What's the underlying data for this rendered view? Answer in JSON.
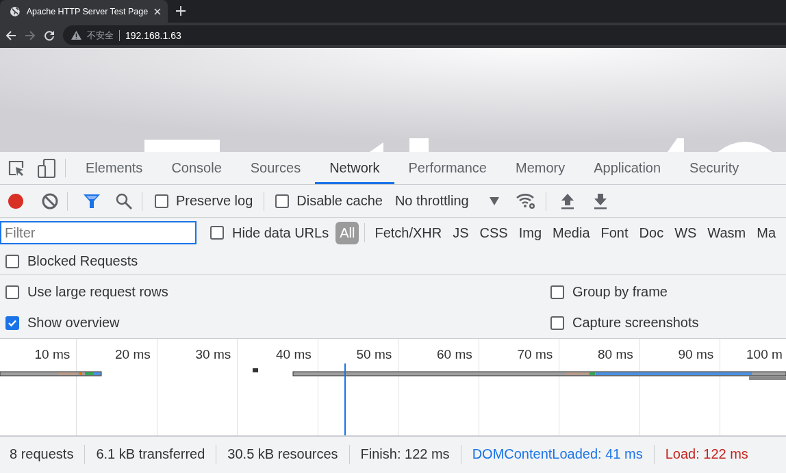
{
  "browser": {
    "tab": {
      "title": "Apache HTTP Server Test Page"
    },
    "address": {
      "security": "不安全",
      "url": "192.168.1.63"
    }
  },
  "devtools": {
    "tabs": [
      {
        "label": "Elements",
        "selected": false
      },
      {
        "label": "Console",
        "selected": false
      },
      {
        "label": "Sources",
        "selected": false
      },
      {
        "label": "Network",
        "selected": true
      },
      {
        "label": "Performance",
        "selected": false
      },
      {
        "label": "Memory",
        "selected": false
      },
      {
        "label": "Application",
        "selected": false
      },
      {
        "label": "Security",
        "selected": false
      }
    ],
    "toolbar": {
      "recording": true,
      "preserve_log": {
        "label": "Preserve log",
        "checked": false
      },
      "disable_cache": {
        "label": "Disable cache",
        "checked": false
      },
      "throttling": "No throttling"
    },
    "filter": {
      "placeholder": "Filter",
      "hide_data_urls": {
        "label": "Hide data URLs",
        "checked": false
      },
      "types": [
        {
          "label": "All",
          "selected": true
        },
        {
          "label": "Fetch/XHR",
          "selected": false
        },
        {
          "label": "JS",
          "selected": false
        },
        {
          "label": "CSS",
          "selected": false
        },
        {
          "label": "Img",
          "selected": false
        },
        {
          "label": "Media",
          "selected": false
        },
        {
          "label": "Font",
          "selected": false
        },
        {
          "label": "Doc",
          "selected": false
        },
        {
          "label": "WS",
          "selected": false
        },
        {
          "label": "Wasm",
          "selected": false
        },
        {
          "label": "Ma",
          "selected": false
        }
      ],
      "blocked_requests": {
        "label": "Blocked Requests",
        "checked": false
      }
    },
    "settings": [
      {
        "label": "Use large request rows",
        "checked": false
      },
      {
        "label": "Group by frame",
        "checked": false
      },
      {
        "label": "Show overview",
        "checked": true
      },
      {
        "label": "Capture screenshots",
        "checked": false
      }
    ],
    "overview": {
      "ticks": [
        "10 ms",
        "20 ms",
        "30 ms",
        "40 ms",
        "50 ms",
        "60 ms",
        "70 ms",
        "80 ms",
        "90 ms",
        "100 m"
      ]
    },
    "status_bar": [
      {
        "text": "8 requests",
        "kind": "plain"
      },
      {
        "text": "6.1 kB transferred",
        "kind": "plain"
      },
      {
        "text": "30.5 kB resources",
        "kind": "plain"
      },
      {
        "text": "Finish: 122 ms",
        "kind": "plain"
      },
      {
        "text": "DOMContentLoaded: 41 ms",
        "kind": "dom"
      },
      {
        "text": "Load: 122 ms",
        "kind": "load"
      }
    ]
  }
}
